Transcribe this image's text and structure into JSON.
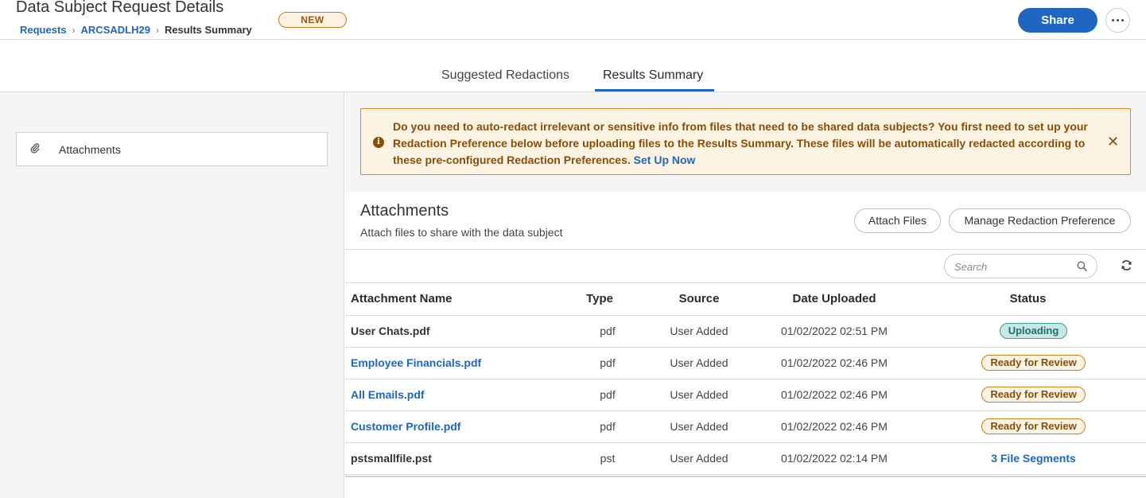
{
  "header": {
    "title": "Data Subject Request Details",
    "status_badge": "NEW",
    "share_label": "Share",
    "breadcrumb": [
      {
        "label": "Requests"
      },
      {
        "label": "ARCSADLH29"
      },
      {
        "label": "Results Summary"
      }
    ],
    "more_icon": "ellipsis-icon"
  },
  "tabs": [
    {
      "label": "Suggested Redactions",
      "active": false
    },
    {
      "label": "Results Summary",
      "active": true
    }
  ],
  "sidebar": {
    "items": [
      {
        "label": "Attachments",
        "icon": "paperclip-icon"
      }
    ]
  },
  "alert": {
    "message": "Do you need to auto-redact irrelevant or sensitive info from files that need to be shared data subjects? You first need to set up your Redaction Preference below before uploading files to the Results Summary. These files will be automatically redacted according to these pre-configured Redaction Preferences.",
    "link_label": "Set Up Now",
    "icon": "info-icon",
    "close_icon": "close-icon",
    "accent": "#d58a2b"
  },
  "attachments": {
    "title": "Attachments",
    "subtitle": "Attach files to share with the data subject",
    "attach_button": "Attach Files",
    "manage_button": "Manage Redaction Preference",
    "search_placeholder": "Search",
    "columns": {
      "name": "Attachment Name",
      "type": "Type",
      "source": "Source",
      "date": "Date Uploaded",
      "status": "Status"
    },
    "rows": [
      {
        "name": "User Chats.pdf",
        "type": "pdf",
        "source": "User Added",
        "date": "01/02/2022 02:51 PM",
        "status": "Uploading"
      },
      {
        "name": "Employee Financials.pdf",
        "type": "pdf",
        "source": "User Added",
        "date": "01/02/2022 02:46 PM",
        "status": "Ready for Review"
      },
      {
        "name": "All Emails.pdf",
        "type": "pdf",
        "source": "User Added",
        "date": "01/02/2022 02:46 PM",
        "status": "Ready for Review"
      },
      {
        "name": "Customer Profile.pdf",
        "type": "pdf",
        "source": "User Added",
        "date": "01/02/2022 02:46 PM",
        "status": "Ready for Review"
      },
      {
        "name": "pstsmallfile.pst",
        "type": "pst",
        "source": "User Added",
        "date": "01/02/2022 02:14 PM",
        "status": "3 File Segments"
      }
    ]
  },
  "colors": {
    "primary": "#1f66c2",
    "warning_bg": "#fdf3e3",
    "warning_text": "#8a4d07",
    "uploading_bg": "#c7e8e5"
  }
}
